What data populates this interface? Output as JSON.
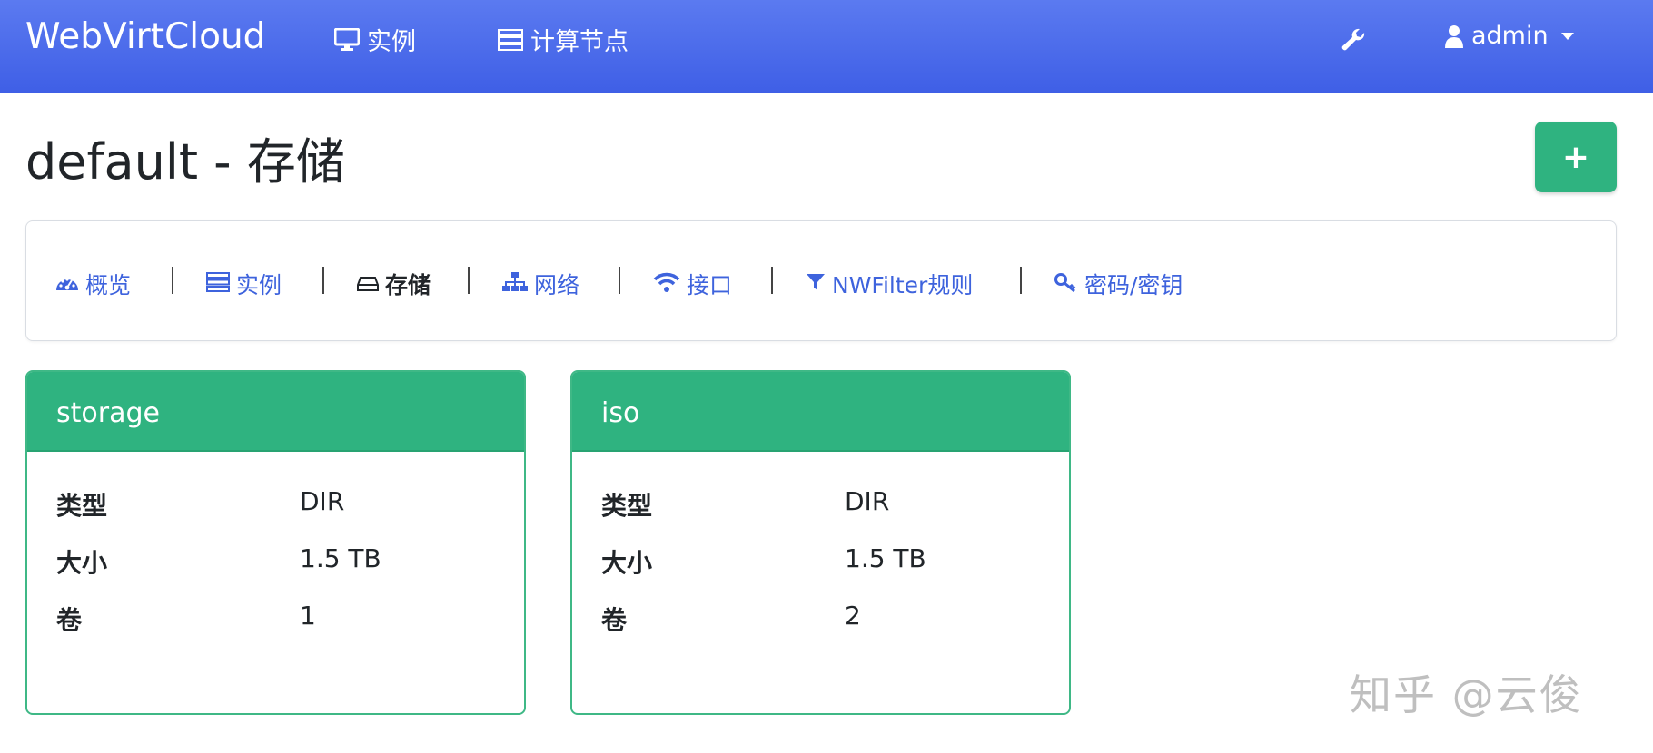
{
  "navbar": {
    "brand": "WebVirtCloud",
    "links": [
      {
        "label": "实例",
        "icon": "desktop-icon"
      },
      {
        "label": "计算节点",
        "icon": "server-icon"
      }
    ],
    "tools_icon": "wrench-icon",
    "user": {
      "label": "admin",
      "icon": "user-icon"
    }
  },
  "page": {
    "title": "default - 存储",
    "add_label": "+"
  },
  "tabs": [
    {
      "label": "概览",
      "icon": "tachometer-icon",
      "active": false
    },
    {
      "label": "实例",
      "icon": "server-icon",
      "active": false
    },
    {
      "label": "存储",
      "icon": "hdd-icon",
      "active": true
    },
    {
      "label": "网络",
      "icon": "sitemap-icon",
      "active": false
    },
    {
      "label": "接口",
      "icon": "wifi-icon",
      "active": false
    },
    {
      "label": "NWFilter规则",
      "icon": "filter-icon",
      "active": false
    },
    {
      "label": "密码/密钥",
      "icon": "key-icon",
      "active": false
    }
  ],
  "pools": [
    {
      "name": "storage",
      "rows": [
        {
          "key": "类型",
          "value": "DIR"
        },
        {
          "key": "大小",
          "value": "1.5 TB"
        },
        {
          "key": "卷",
          "value": "1"
        }
      ]
    },
    {
      "name": "iso",
      "rows": [
        {
          "key": "类型",
          "value": "DIR"
        },
        {
          "key": "大小",
          "value": "1.5 TB"
        },
        {
          "key": "卷",
          "value": "2"
        }
      ]
    }
  ],
  "colors": {
    "navbar": "#4a6cec",
    "accent": "#2fb380",
    "link": "#3e63dd"
  },
  "watermark": "知乎 @云俊"
}
